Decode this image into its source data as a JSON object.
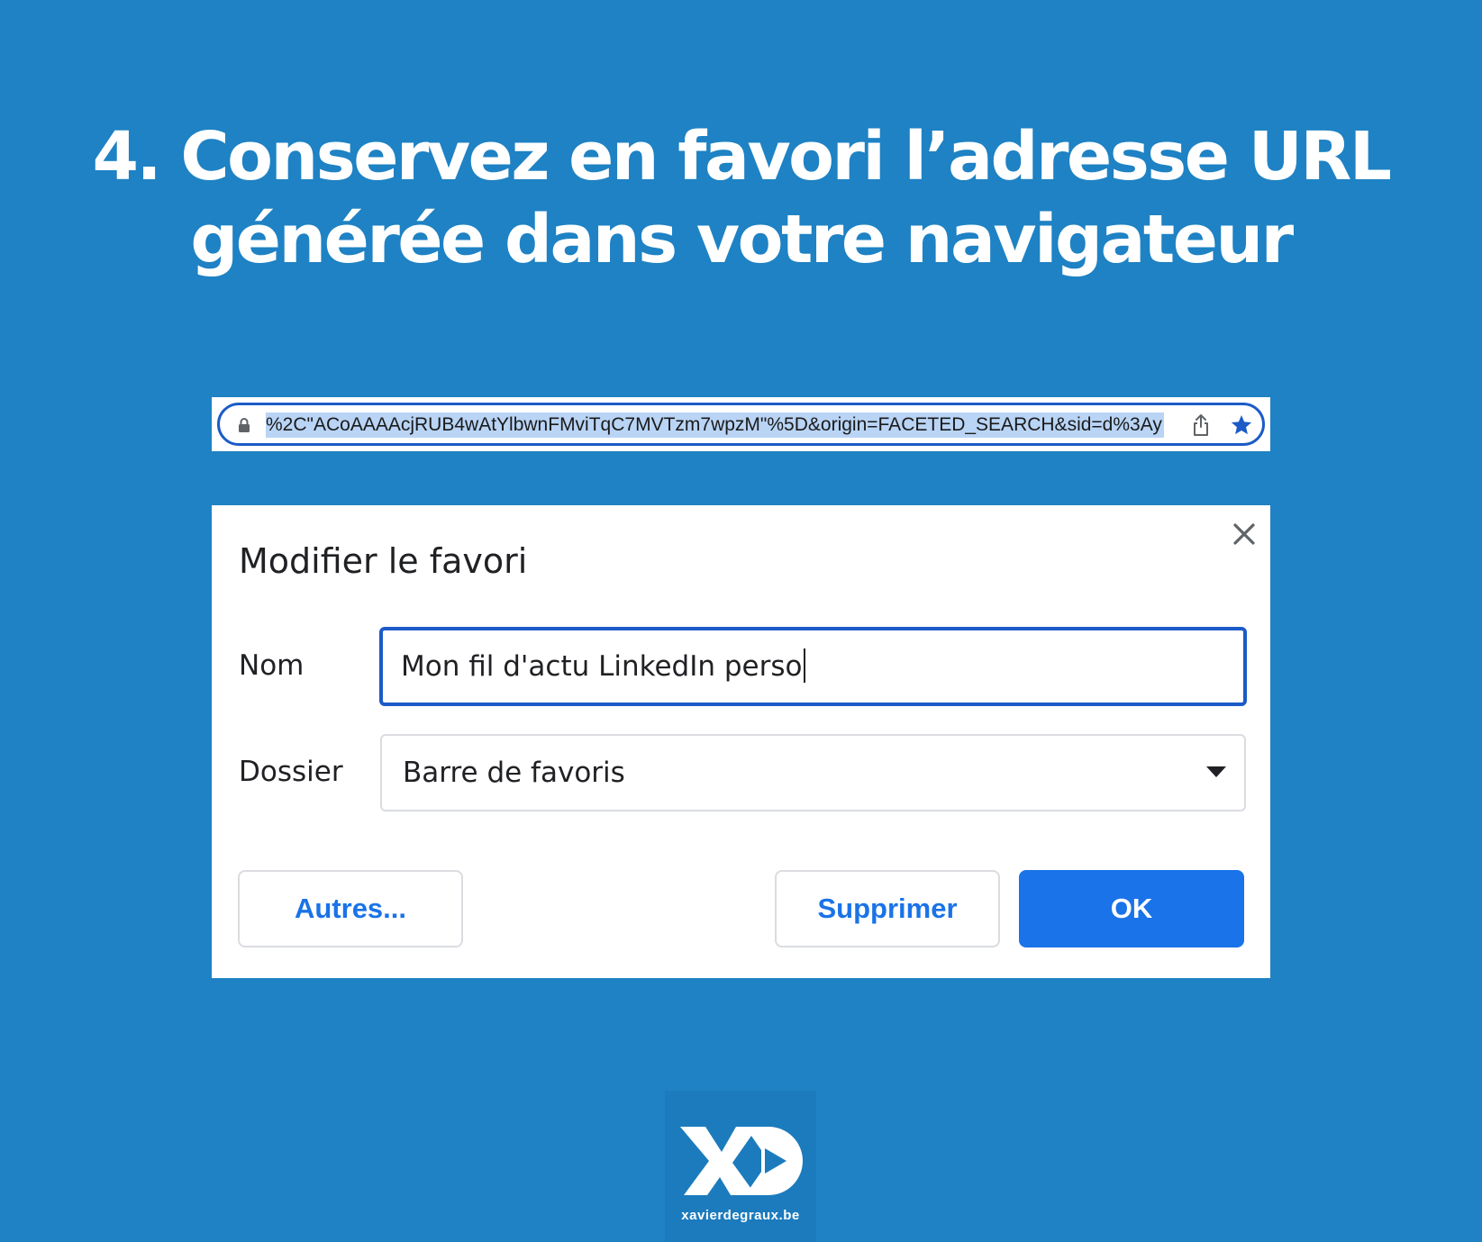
{
  "headline": {
    "line1": "4. Conservez en favori l’adresse URL",
    "line2": "générée dans votre navigateur"
  },
  "address_bar": {
    "url": "%2C\"ACoAAAAcjRUB4wAtYlbwnFMviTqC7MVTzm7wpzM\"%5D&origin=FACETED_SEARCH&sid=d%3Ay",
    "icons": [
      "lock-icon",
      "share-icon",
      "star-icon"
    ]
  },
  "dialog": {
    "title": "Modifier le favori",
    "name_label": "Nom",
    "name_value": "Mon fil d'actu LinkedIn perso",
    "folder_label": "Dossier",
    "folder_value": "Barre de favoris",
    "buttons": {
      "more": "Autres...",
      "delete": "Supprimer",
      "ok": "OK"
    }
  },
  "brand": {
    "site": "xavierdegraux.be"
  },
  "colors": {
    "background": "#1e82c4",
    "accent": "#1a73e8",
    "focus_border": "#1c5bc7",
    "selection": "#b9d4f5"
  }
}
